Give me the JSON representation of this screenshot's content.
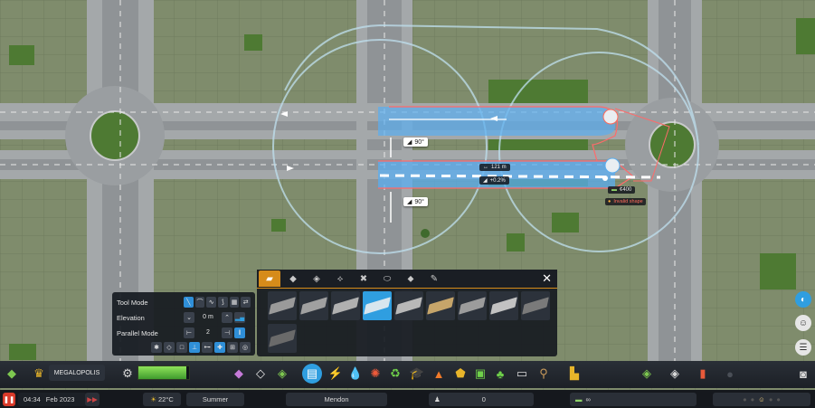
{
  "measurements": {
    "angle_top": "90°",
    "angle_bottom": "90°",
    "length": "121 m",
    "slope": "+0.2%",
    "cost": "¢400",
    "warning": "Invalid shape"
  },
  "tool_panel": {
    "tool_mode_label": "Tool Mode",
    "elevation_label": "Elevation",
    "elevation_value": "0 m",
    "parallel_mode_label": "Parallel Mode",
    "parallel_value": "2"
  },
  "asset_panel": {
    "tabs": [
      "road-small-icon",
      "road-medium-icon",
      "road-large-icon",
      "highway-icon",
      "intersection-icon",
      "roundabout-icon",
      "pathway-icon",
      "tools-icon"
    ],
    "selected_index": 3,
    "close_label": "✕"
  },
  "toolbar": {
    "city_name": "MEGALOPOLIS",
    "icons": [
      "zoning-icon",
      "area-icon",
      "landscaping-icon",
      "roads-icon",
      "electricity-icon",
      "water-icon",
      "health-icon",
      "garbage-icon",
      "education-icon",
      "fire-icon",
      "police-icon",
      "transport-icon",
      "parks-icon",
      "communication-icon",
      "landscape-icon",
      "industry-icon",
      "map-tiles-icon",
      "districts-icon",
      "statistics-icon",
      "camera-icon"
    ]
  },
  "statusbar": {
    "time": "04:34",
    "date": "Feb 2023",
    "temperature": "22°C",
    "season": "Summer",
    "city": "Mendon",
    "population": "0",
    "money": "∞"
  },
  "colors": {
    "accent": "#d68b1a",
    "selected": "#2f9ee0",
    "road_preview": "#5aaef0",
    "warning": "#ff6a5a"
  }
}
